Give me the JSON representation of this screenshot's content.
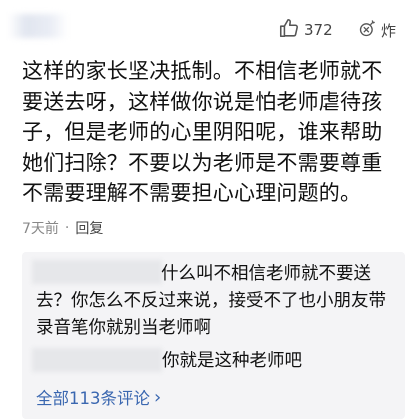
{
  "header": {
    "likes": "372",
    "dislike_label": "炸"
  },
  "comment": {
    "text": "这样的家长坚决抵制。不相信老师就不要送去呀，这样做你说是怕老师虐待孩子，但是老师的心里阴阳呢，谁来帮助她们扫除？不要以为老师是不需要尊重不需要理解不需要担心心理问题的。",
    "time": "7天前",
    "separator": "·",
    "reply_label": "回复"
  },
  "replies": [
    {
      "text": "什么叫不相信老师就不要送去？你怎么不反过来说，接受不了也小朋友带录音笔你就别当老师啊"
    },
    {
      "text": "你就是这种老师吧"
    }
  ],
  "footer": {
    "all_comments": "全部113条评论",
    "chevron": "›"
  }
}
